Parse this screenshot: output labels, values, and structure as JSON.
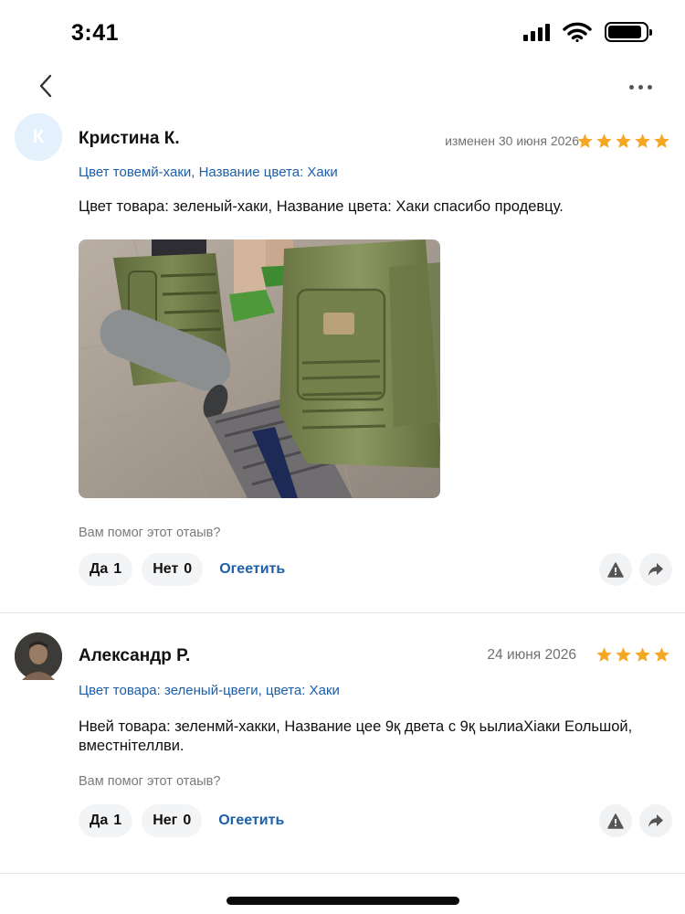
{
  "status_bar": {
    "time": "3:41",
    "signal_bars": 4,
    "battery_level": 0.9
  },
  "nav": {
    "back_icon": "chevron-left-icon",
    "more_icon": "ellipsis-icon"
  },
  "colors": {
    "accent": "#1d5fa8",
    "star": "#f5a623",
    "muted": "#707070",
    "pill_bg": "#f3f4f6"
  },
  "reviews": [
    {
      "avatar_initial": "К",
      "author": "Кристина К.",
      "date": "изменен 30 июня 2026",
      "rating": 5,
      "variant": "Цвет товемй-хаки, Название цвета: Хаки",
      "text": "Цвет товара: зеленый-хаки, Название цвета: Хаки спасибо продевцу.",
      "helpful_question": "Вам помог этот отаыв?",
      "yes_label": "Да",
      "yes_count": "1",
      "no_label": "Нет",
      "no_count": "0",
      "reply_label": "Огеетить"
    },
    {
      "avatar_initial": "",
      "author": "Александр Р.",
      "date": "24 июня 2026",
      "rating": 4,
      "variant": "Цвет товара: зеленый-цвеги, цвета: Хаки",
      "text": "Нвей товара: зеленмй-хакки, Название цее 9қ двета с 9қ ьылиаХіаки Еольшой, вместнітеллви.",
      "helpful_question": "Вам помог этот отаыв?",
      "yes_label": "Да",
      "yes_count": "1",
      "no_label": "Нег",
      "no_count": "0",
      "reply_label": "Огеетить"
    }
  ]
}
